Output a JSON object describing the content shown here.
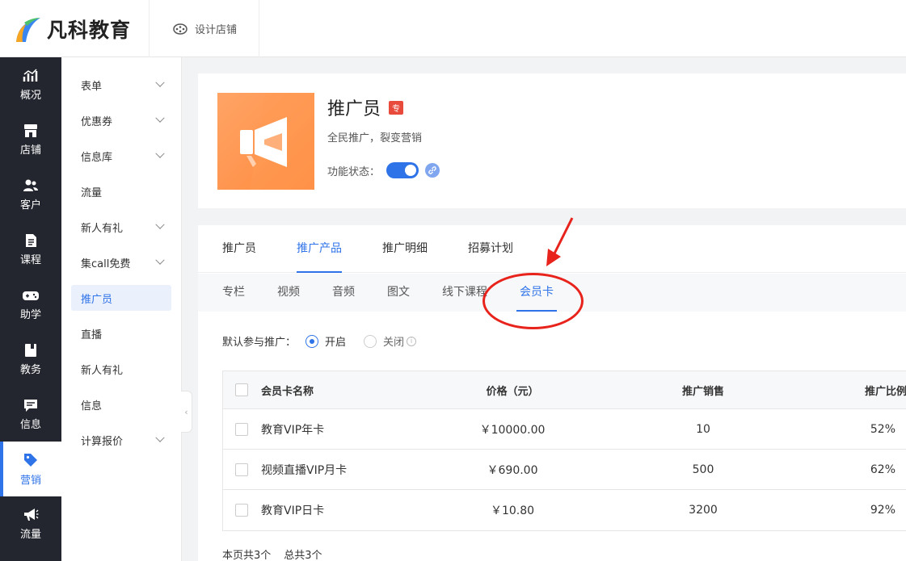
{
  "brand": {
    "name": "凡科教育"
  },
  "topbar": {
    "design_label": "设计店铺"
  },
  "nav": {
    "items": [
      {
        "label": "概况",
        "icon": "chart-icon"
      },
      {
        "label": "店铺",
        "icon": "store-icon"
      },
      {
        "label": "客户",
        "icon": "users-icon"
      },
      {
        "label": "课程",
        "icon": "document-icon"
      },
      {
        "label": "助学",
        "icon": "gamepad-icon"
      },
      {
        "label": "教务",
        "icon": "book-icon"
      },
      {
        "label": "信息",
        "icon": "message-icon"
      },
      {
        "label": "营销",
        "icon": "tag-icon",
        "active": true
      },
      {
        "label": "流量",
        "icon": "megaphone-icon"
      }
    ]
  },
  "submenu": {
    "items": [
      {
        "label": "表单",
        "expandable": true
      },
      {
        "label": "优惠券",
        "expandable": true
      },
      {
        "label": "信息库",
        "expandable": true
      },
      {
        "label": "流量",
        "expandable": false
      },
      {
        "label": "新人有礼",
        "expandable": true
      },
      {
        "label": "集call免费",
        "expandable": true
      },
      {
        "label": "推广员",
        "expandable": false,
        "active": true
      },
      {
        "label": "直播",
        "expandable": false
      },
      {
        "label": "新人有礼",
        "expandable": false
      },
      {
        "label": "信息",
        "expandable": false
      },
      {
        "label": "计算报价",
        "expandable": true
      }
    ]
  },
  "feature": {
    "title": "推广员",
    "badge": "专",
    "subtitle": "全民推广，裂变营销",
    "status_label": "功能状态：",
    "enabled": true
  },
  "tabs": [
    {
      "label": "推广员"
    },
    {
      "label": "推广产品",
      "active": true
    },
    {
      "label": "推广明细"
    },
    {
      "label": "招募计划"
    }
  ],
  "subtabs": [
    {
      "label": "专栏"
    },
    {
      "label": "视频"
    },
    {
      "label": "音频"
    },
    {
      "label": "图文"
    },
    {
      "label": "线下课程"
    },
    {
      "label": "会员卡",
      "active": true
    }
  ],
  "default_promo": {
    "label": "默认参与推广：",
    "options": [
      {
        "label": "开启",
        "selected": true
      },
      {
        "label": "关闭",
        "selected": false
      }
    ]
  },
  "table": {
    "headers": {
      "name": "会员卡名称",
      "price": "价格（元）",
      "sales": "推广销售",
      "ratio": "推广比例"
    },
    "rows": [
      {
        "name": "教育VIP年卡",
        "price": "￥10000.00",
        "sales": "10",
        "ratio": "52%"
      },
      {
        "name": "视频直播VIP月卡",
        "price": "￥690.00",
        "sales": "500",
        "ratio": "62%"
      },
      {
        "name": "教育VIP日卡",
        "price": "￥10.80",
        "sales": "3200",
        "ratio": "92%"
      }
    ]
  },
  "footer": {
    "page_count": "本页共3个",
    "total_count": "总共3个"
  },
  "colors": {
    "accent": "#2f73e8",
    "nav_bg": "#23262e",
    "annotation": "#e8231c"
  }
}
